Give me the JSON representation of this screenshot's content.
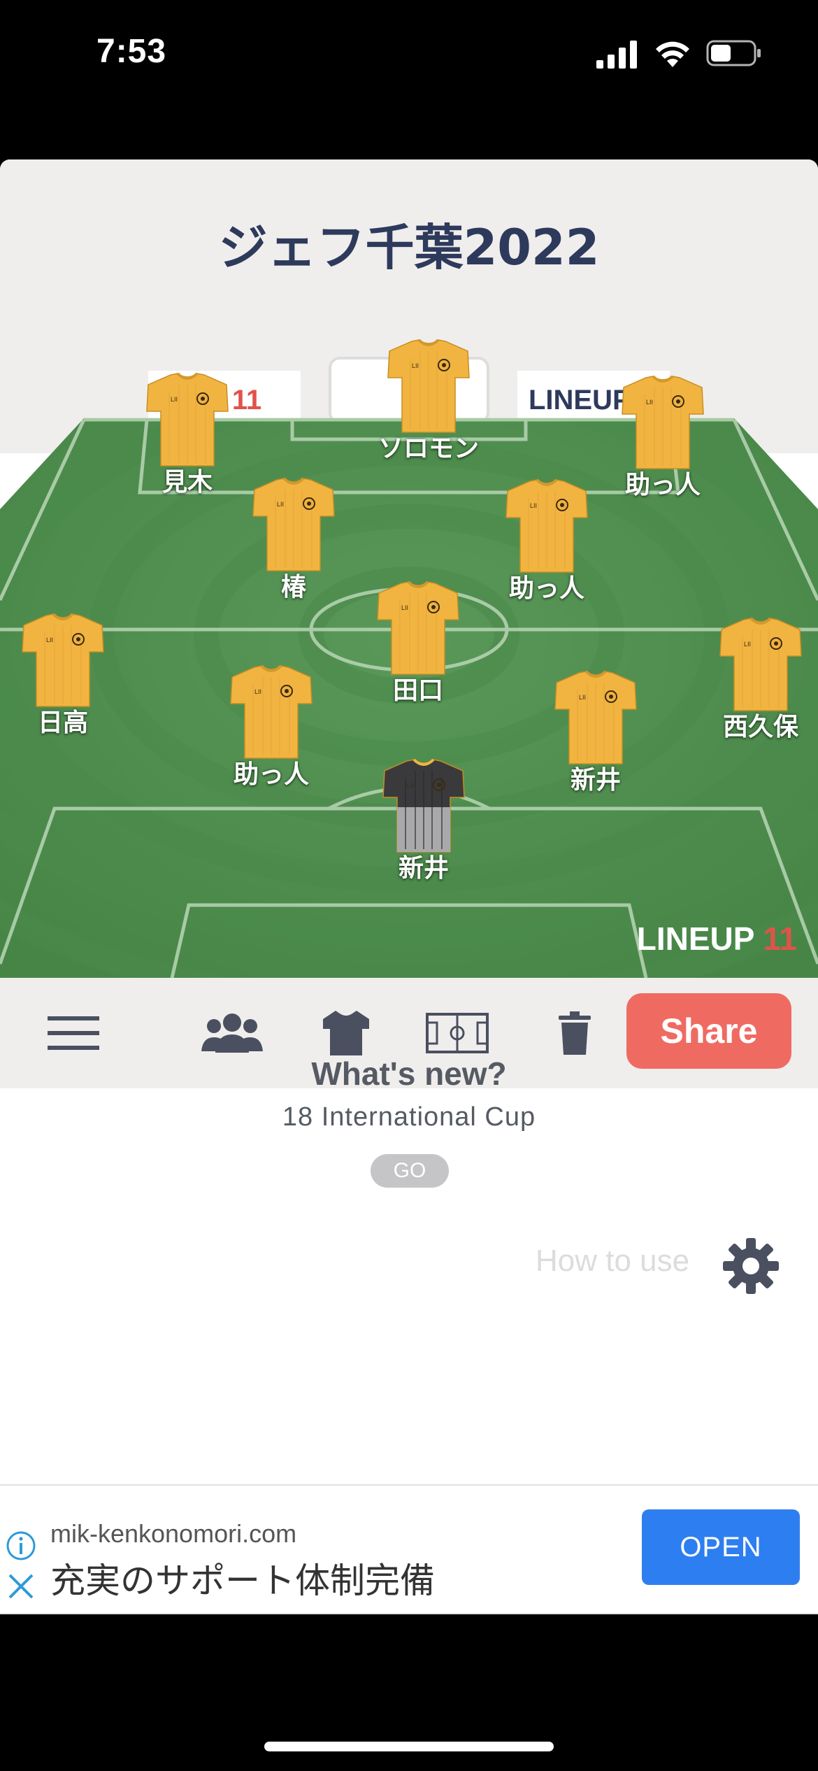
{
  "status": {
    "time": "7:53"
  },
  "lineup": {
    "title": "ジェフ千葉2022",
    "watermark": "LINEUP11",
    "ad_board_left": "UP11",
    "ad_board_right": "LINEUP",
    "players": [
      {
        "name": "ソロモン",
        "kit": "outfield"
      },
      {
        "name": "見木",
        "kit": "outfield"
      },
      {
        "name": "助っ人",
        "kit": "outfield"
      },
      {
        "name": "椿",
        "kit": "outfield"
      },
      {
        "name": "助っ人",
        "kit": "outfield"
      },
      {
        "name": "田口",
        "kit": "outfield"
      },
      {
        "name": "日高",
        "kit": "outfield"
      },
      {
        "name": "西久保",
        "kit": "outfield"
      },
      {
        "name": "助っ人",
        "kit": "outfield"
      },
      {
        "name": "新井",
        "kit": "outfield"
      },
      {
        "name": "新井",
        "kit": "goalkeeper"
      }
    ]
  },
  "toolbar": {
    "items": [
      {
        "icon": "menu-icon"
      },
      {
        "icon": "team-icon"
      },
      {
        "icon": "jersey-icon"
      },
      {
        "icon": "pitch-icon"
      },
      {
        "icon": "trash-icon"
      }
    ],
    "share_label": "Share"
  },
  "whats_new": {
    "title": "What's new?",
    "subtitle": "18 International Cup",
    "go_label": "GO"
  },
  "how_to_use": "How to use",
  "ad": {
    "domain": "mik-kenkonomori.com",
    "text": "充実のサポート体制完備",
    "open_label": "OPEN"
  },
  "colors": {
    "shirt": "#f2b441",
    "goalkeeper_shirt": "#3a3a3c",
    "pitch_dark": "#4f8d4f",
    "pitch_light": "#5c9a5c",
    "share": "#ef6b62",
    "open": "#2d7ef0",
    "title": "#2e3a5c"
  }
}
